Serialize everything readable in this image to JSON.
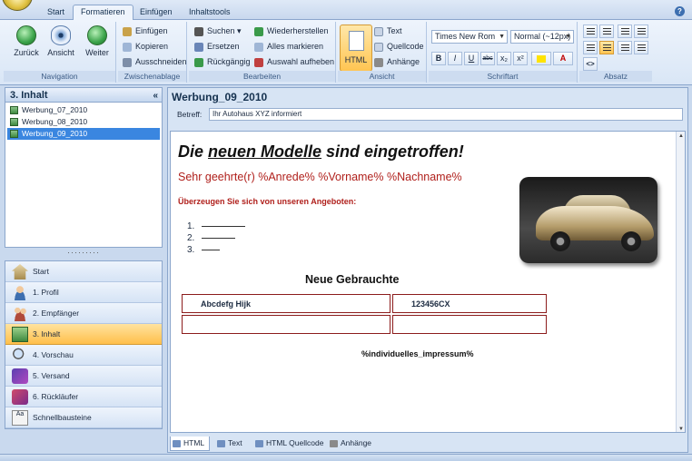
{
  "tabs": [
    "Start",
    "Formatieren",
    "Einfügen",
    "Inhaltstools"
  ],
  "active_tab_index": 1,
  "ribbon": {
    "navigation": {
      "label": "Navigation",
      "back": "Zurück",
      "view": "Ansicht",
      "forward": "Weiter"
    },
    "clipboard": {
      "label": "Zwischenablage",
      "paste": "Einfügen",
      "copy": "Kopieren",
      "cut": "Ausschneiden"
    },
    "edit": {
      "label": "Bearbeiten",
      "search": "Suchen",
      "replace": "Ersetzen",
      "undo": "Rückgängig",
      "redo": "Wiederherstellen",
      "select_all": "Alles markieren",
      "deselect": "Auswahl aufheben"
    },
    "view": {
      "label": "Ansicht",
      "html": "HTML",
      "text": "Text",
      "source": "Quellcode",
      "attachments": "Anhänge"
    },
    "font": {
      "label": "Schriftart",
      "family": "Times New Rom",
      "size": "Normal (~12px)",
      "bold": "B",
      "italic": "I",
      "underline": "U",
      "strike": "abc",
      "subscript": "x₂",
      "superscript": "x²",
      "font_color": "A"
    },
    "paragraph": {
      "label": "Absatz",
      "source_toggle": "<>"
    }
  },
  "left_panel": {
    "title": "3. Inhalt",
    "tree": [
      "Werbung_07_2010",
      "Werbung_08_2010",
      "Werbung_09_2010"
    ],
    "selected_index": 2,
    "nav": [
      "Start",
      "1. Profil",
      "2. Empfänger",
      "3. Inhalt",
      "4. Vorschau",
      "5. Versand",
      "6. Rückläufer",
      "Schnellbausteine"
    ],
    "active_nav_index": 3
  },
  "document": {
    "title": "Werbung_09_2010",
    "subject_label": "Betreff:",
    "subject_value": "Ihr Autohaus XYZ informiert",
    "headline_pre": "Die ",
    "headline_em": "neuen Modelle",
    "headline_post": " sind eingetroffen!",
    "salutation": "Sehr geehrte(r) %Anrede% %Vorname% %Nachname%",
    "subline": "Überzeugen Sie sich von unseren Angeboten:",
    "list_numbers": [
      "1.",
      "2.",
      "3."
    ],
    "section_title": "Neue Gebrauchte",
    "table": [
      [
        "Abcdefg Hijk",
        "123456CX"
      ],
      [
        "",
        ""
      ]
    ],
    "imprint": "%individuelles_impressum%"
  },
  "editor_tabs": [
    "HTML",
    "Text",
    "HTML Quellcode",
    "Anhänge"
  ],
  "colors": {
    "accent": "#3a86e0",
    "highlight": "#ffc552",
    "salutation": "#b0201c"
  }
}
